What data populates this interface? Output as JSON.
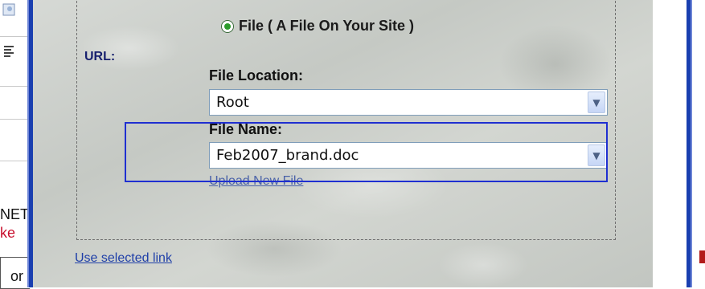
{
  "background": {
    "left_fragments": [
      "NET",
      "ke",
      "or"
    ],
    "accent_red": "#c8102e",
    "accent_blue": "#1a3fb0"
  },
  "dialog": {
    "radio_file_label": "File ( A File On Your Site )",
    "url_label": "URL:",
    "file_location": {
      "label": "File Location:",
      "value": "Root"
    },
    "file_name": {
      "label": "File Name:",
      "value": "Feb2007_brand.doc"
    },
    "upload_link": "Upload New File",
    "use_link": "Use selected link"
  }
}
